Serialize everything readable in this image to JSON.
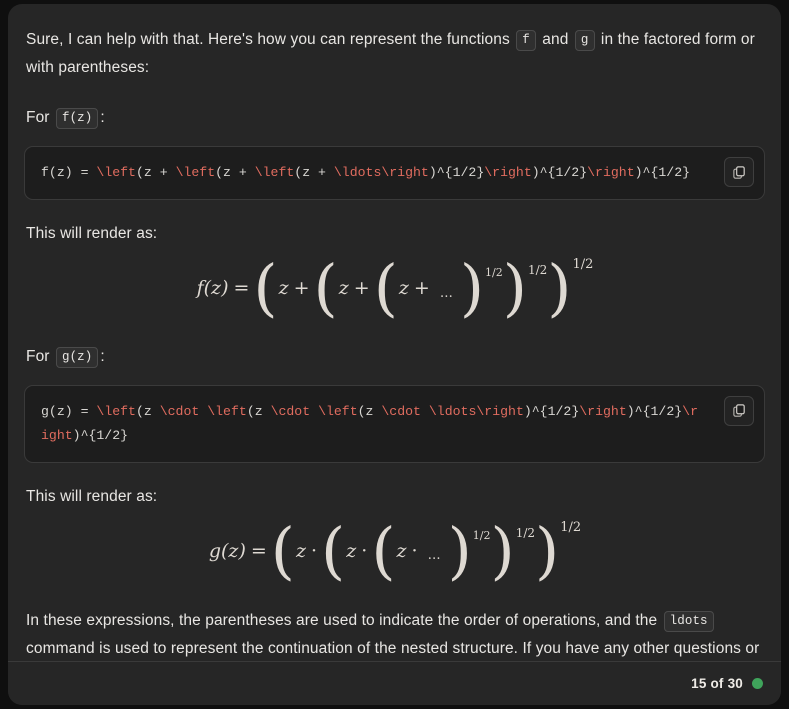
{
  "intro": {
    "text_before_f": "Sure, I can help with that. Here's how you can represent the functions",
    "chip_f": "f",
    "text_and": "and",
    "chip_g": "g",
    "text_after": "in the factored form or with parentheses:"
  },
  "section_f": {
    "for_label": "For",
    "chip": "f(z)",
    "colon": ":",
    "code": {
      "tokens": [
        {
          "t": "f(z) = ",
          "k": false
        },
        {
          "t": "\\left",
          "k": true
        },
        {
          "t": "(z + ",
          "k": false
        },
        {
          "t": "\\left",
          "k": true
        },
        {
          "t": "(z + ",
          "k": false
        },
        {
          "t": "\\left",
          "k": true
        },
        {
          "t": "(z + ",
          "k": false
        },
        {
          "t": "\\ldots",
          "k": true
        },
        {
          "t": "\\right",
          "k": true
        },
        {
          "t": ")^{1/2}",
          "k": false
        },
        {
          "t": "\\right",
          "k": true
        },
        {
          "t": ")^{1/2}",
          "k": false
        },
        {
          "t": "\\right",
          "k": true
        },
        {
          "t": ")^{1/2}",
          "k": false
        }
      ],
      "copy_label": "copy-code"
    },
    "render_label": "This will render as:",
    "math": {
      "lhs": "f(z)",
      "equals": "=",
      "variable": "z",
      "operator": "+",
      "ldots": "…",
      "exponent": "1/2"
    }
  },
  "section_g": {
    "for_label": "For",
    "chip": "g(z)",
    "colon": ":",
    "code": {
      "tokens": [
        {
          "t": "g(z) = ",
          "k": false
        },
        {
          "t": "\\left",
          "k": true
        },
        {
          "t": "(z ",
          "k": false
        },
        {
          "t": "\\cdot",
          "k": true
        },
        {
          "t": " ",
          "k": false
        },
        {
          "t": "\\left",
          "k": true
        },
        {
          "t": "(z ",
          "k": false
        },
        {
          "t": "\\cdot",
          "k": true
        },
        {
          "t": " ",
          "k": false
        },
        {
          "t": "\\left",
          "k": true
        },
        {
          "t": "(z ",
          "k": false
        },
        {
          "t": "\\cdot",
          "k": true
        },
        {
          "t": " ",
          "k": false
        },
        {
          "t": "\\ldots",
          "k": true
        },
        {
          "t": "\\right",
          "k": true
        },
        {
          "t": ")^{1/2}",
          "k": false
        },
        {
          "t": "\\right",
          "k": true
        },
        {
          "t": ")^{1/2}",
          "k": false
        },
        {
          "t": "\\right",
          "k": true
        },
        {
          "t": ")^{1/2}",
          "k": false
        }
      ],
      "copy_label": "copy-code"
    },
    "render_label": "This will render as:",
    "math": {
      "lhs": "g(z)",
      "equals": "=",
      "variable": "z",
      "operator": "·",
      "ldots": "…",
      "exponent": "1/2"
    }
  },
  "closing": {
    "text_before_chip": "In these expressions, the parentheses are used to indicate the order of operations, and the",
    "chip": "ldots",
    "text_after_chip": "command is used to represent the continuation of the nested structure. If you have any other questions or need further assistance, feel free to ask!"
  },
  "footer": {
    "counter": "15 of 30",
    "status": "online"
  },
  "colors": {
    "page_bg": "#0f0f0f",
    "panel_bg": "#262626",
    "code_bg": "#1d1d1d",
    "keyword": "#e06c5f",
    "text": "#e8e6e3",
    "status_green": "#3fa45b"
  }
}
